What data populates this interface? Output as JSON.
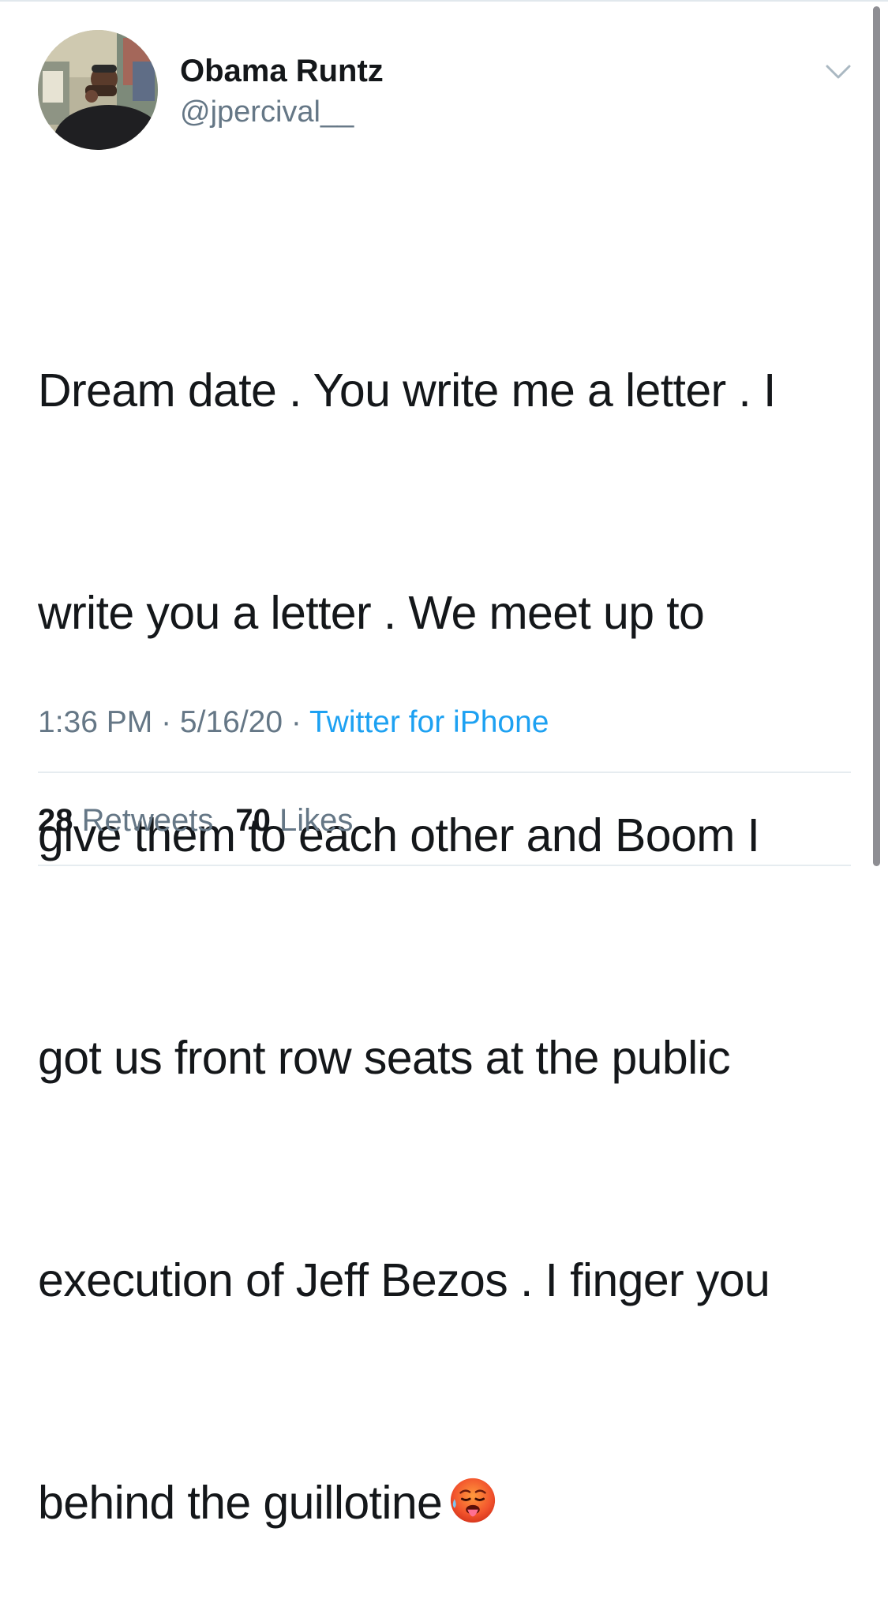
{
  "tweet": {
    "author": {
      "display_name": "Obama Runtz",
      "handle": "@jpercival__"
    },
    "text_lines": [
      "Dream date . You write me a letter . I",
      "write you a letter . We meet up to",
      "give them to each other and Boom I",
      "got us front row seats at the public",
      "execution of Jeff Bezos . I finger  you",
      "behind the guillotine"
    ],
    "emoji_icon": "hot-face-emoji-icon",
    "time": "1:36 PM",
    "separator": " · ",
    "date": "5/16/20",
    "source": "Twitter for iPhone",
    "stats": {
      "retweets_count": "28",
      "retweets_label": "Retweets",
      "likes_count": "70",
      "likes_label": "Likes"
    }
  },
  "icons": {
    "more_menu": "chevron-down-icon"
  },
  "colors": {
    "text_primary": "#14171a",
    "text_secondary": "#657786",
    "link": "#1da1f2",
    "divider": "#e6ecf0"
  }
}
